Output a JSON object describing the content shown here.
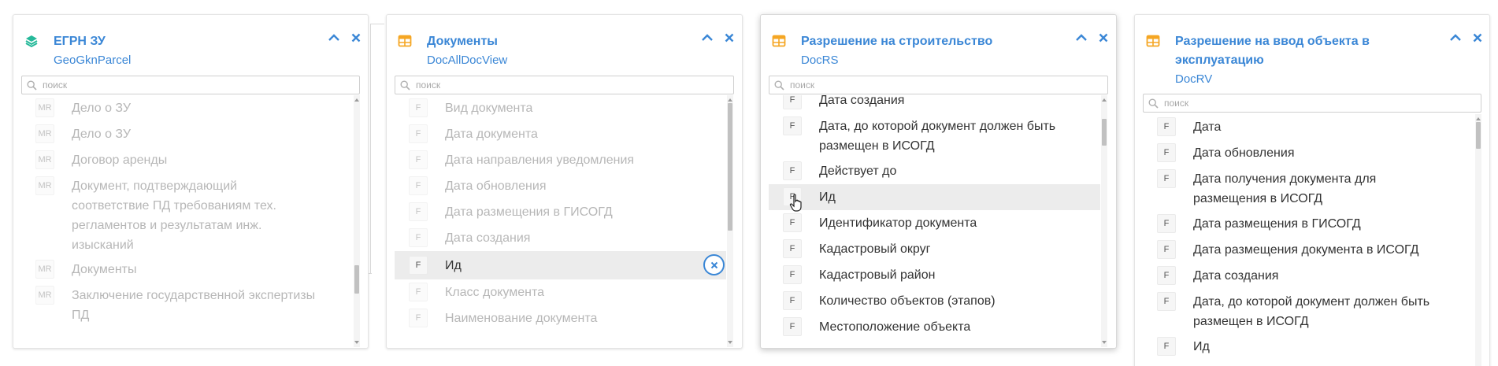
{
  "colors": {
    "accent": "#3b87d6",
    "layer_icon": "#26b99a",
    "table_icon": "#f5a623"
  },
  "search": {
    "placeholder": "поиск"
  },
  "cards": [
    {
      "title": "ЕГРН ЗУ",
      "subtitle": "GeoGknParcel",
      "icon": "layers-icon",
      "items": [
        {
          "badge": "MR",
          "label": "Дело о ЗУ"
        },
        {
          "badge": "MR",
          "label": "Дело о ЗУ"
        },
        {
          "badge": "MR",
          "label": "Договор аренды"
        },
        {
          "badge": "MR",
          "label": "Документ, подтверждающий соответствие ПД требованиям тех. регламентов и результатам инж. изысканий"
        },
        {
          "badge": "MR",
          "label": "Документы"
        },
        {
          "badge": "MR",
          "label": "Заключение государственной экспертизы ПД"
        }
      ]
    },
    {
      "title": "Документы",
      "subtitle": "DocAllDocView",
      "icon": "table-icon",
      "items": [
        {
          "badge": "F",
          "label": "Вид документа"
        },
        {
          "badge": "F",
          "label": "Дата документа"
        },
        {
          "badge": "F",
          "label": "Дата направления уведомления"
        },
        {
          "badge": "F",
          "label": "Дата обновления"
        },
        {
          "badge": "F",
          "label": "Дата размещения в ГИСОГД"
        },
        {
          "badge": "F",
          "label": "Дата создания"
        },
        {
          "badge": "F",
          "label": "Ид"
        },
        {
          "badge": "F",
          "label": "Класс документа"
        },
        {
          "badge": "F",
          "label": "Наименование документа"
        }
      ]
    },
    {
      "title": "Разрешение на строительство",
      "subtitle": "DocRS",
      "icon": "table-icon",
      "items": [
        {
          "badge": "F",
          "label": "Дата создания"
        },
        {
          "badge": "F",
          "label": "Дата, до которой документ должен быть размещен в ИСОГД"
        },
        {
          "badge": "F",
          "label": "Действует до"
        },
        {
          "badge": "F",
          "label": "Ид"
        },
        {
          "badge": "F",
          "label": "Идентификатор документа"
        },
        {
          "badge": "F",
          "label": "Кадастровый округ"
        },
        {
          "badge": "F",
          "label": "Кадастровый район"
        },
        {
          "badge": "F",
          "label": "Количество объектов (этапов)"
        },
        {
          "badge": "F",
          "label": "Местоположение объекта"
        }
      ]
    },
    {
      "title": "Разрешение на ввод объекта в эксплуатацию",
      "subtitle": "DocRV",
      "icon": "table-icon",
      "items": [
        {
          "badge": "F",
          "label": "Дата"
        },
        {
          "badge": "F",
          "label": "Дата обновления"
        },
        {
          "badge": "F",
          "label": "Дата получения документа для размещения в ИСОГД"
        },
        {
          "badge": "F",
          "label": "Дата размещения в ГИСОГД"
        },
        {
          "badge": "F",
          "label": "Дата размещения документа в ИСОГД"
        },
        {
          "badge": "F",
          "label": "Дата создания"
        },
        {
          "badge": "F",
          "label": "Дата, до которой документ должен быть размещен в ИСОГД"
        },
        {
          "badge": "F",
          "label": "Ид"
        }
      ]
    }
  ]
}
